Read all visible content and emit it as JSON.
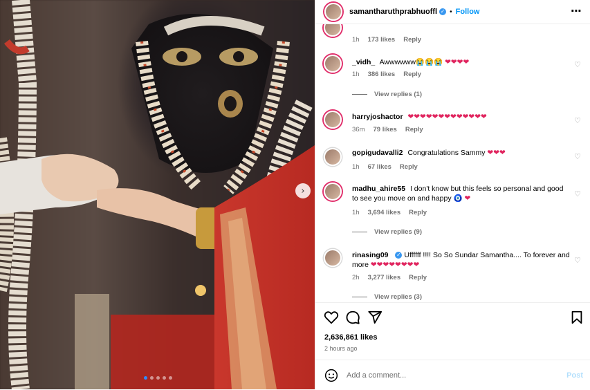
{
  "post": {
    "username": "samantharuthprabhuoffl",
    "follow_label": "Follow",
    "bullet": "•",
    "more_icon": "more-options-icon",
    "carousel_next": "›"
  },
  "comments": [
    {
      "user": "",
      "text": "",
      "time": "1h",
      "likes": "173 likes",
      "reply": "Reply"
    },
    {
      "user": "_vidh_",
      "text": "Awwwwww😭😭😭",
      "hearts": "❤❤❤❤",
      "time": "1h",
      "likes": "386 likes",
      "reply": "Reply",
      "view_replies": "View replies (1)"
    },
    {
      "user": "harryjoshactor",
      "text": "",
      "hearts": "❤❤❤❤❤❤❤❤❤❤❤❤❤",
      "time": "36m",
      "likes": "79 likes",
      "reply": "Reply"
    },
    {
      "user": "gopigudavalli2",
      "text": "Congratulations Sammy",
      "hearts": "❤❤❤",
      "time": "1h",
      "likes": "67 likes",
      "reply": "Reply"
    },
    {
      "user": "madhu_ahire55",
      "text": "I don't know but this feels so personal and good to see you move on and happy 🧿",
      "hearts": "❤",
      "time": "1h",
      "likes": "3,694 likes",
      "reply": "Reply",
      "view_replies": "View replies (9)"
    },
    {
      "user": "rinasing09",
      "text": "Uffffff !!!! So So Sundar Samantha.... To forever and more",
      "hearts": "❤❤❤❤❤❤❤❤",
      "time": "2h",
      "likes": "3,277 likes",
      "reply": "Reply",
      "view_replies": "View replies (3)"
    }
  ],
  "footer": {
    "likes": "2,636,861 likes",
    "time": "2 hours ago",
    "add_comment_placeholder": "Add a comment...",
    "post_label": "Post"
  },
  "colors": {
    "accent": "#0095f6",
    "verified": "#3897f0",
    "heart": "#e0245e"
  }
}
